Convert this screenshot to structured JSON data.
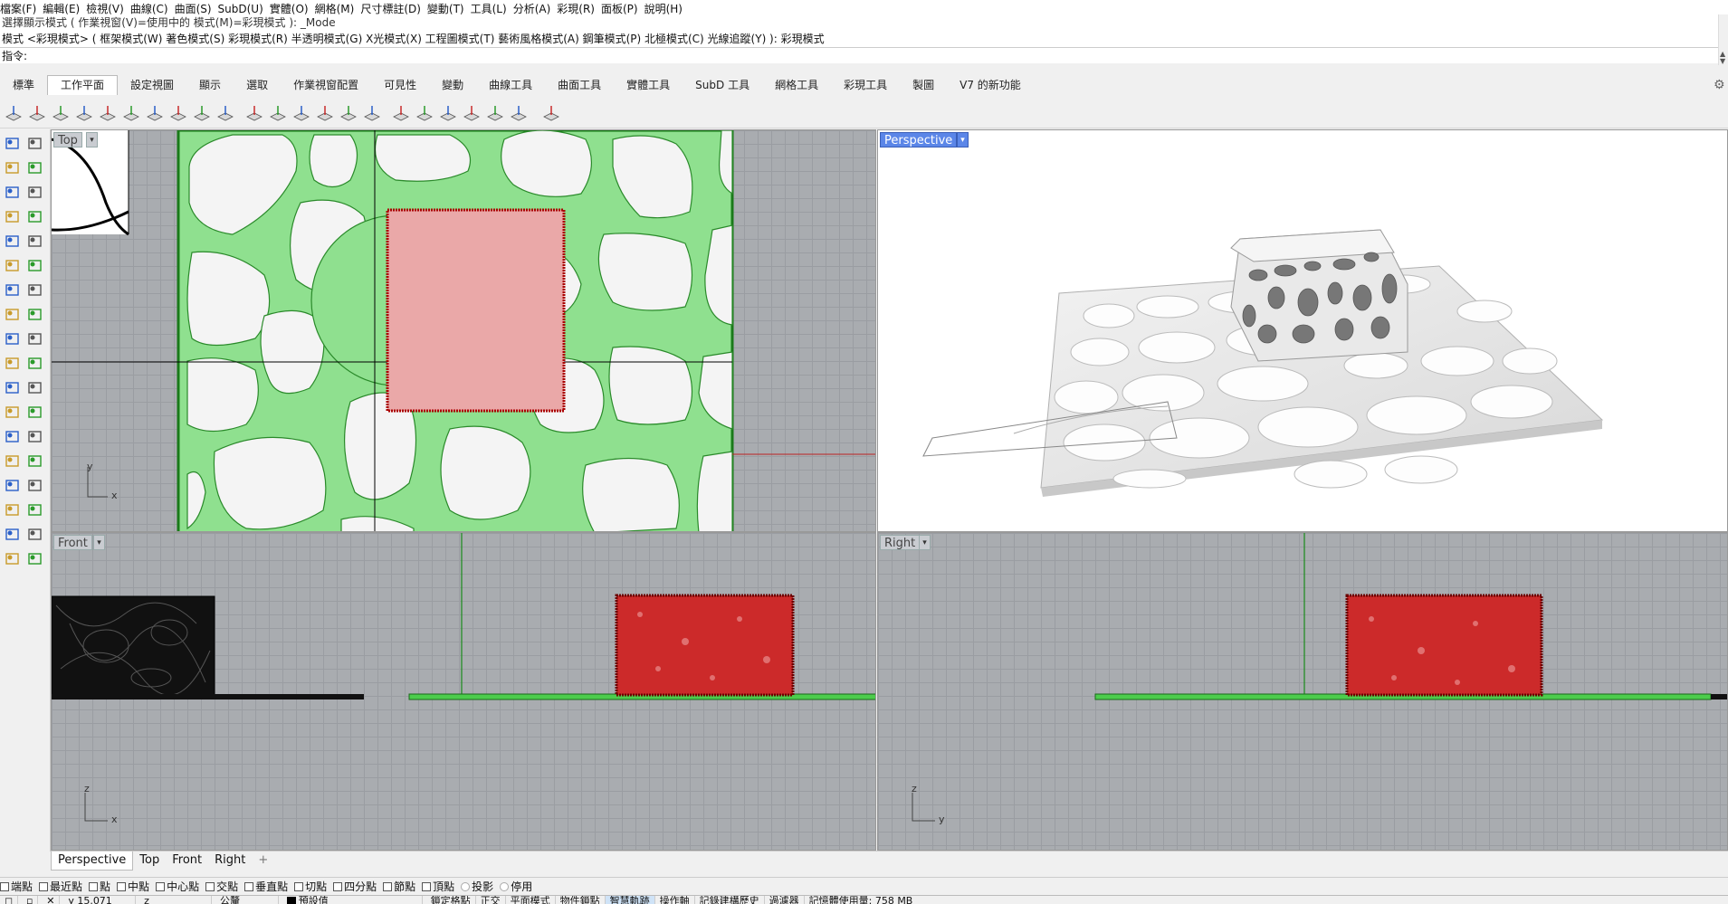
{
  "menu": [
    "檔案(F)",
    "編輯(E)",
    "檢視(V)",
    "曲線(C)",
    "曲面(S)",
    "SubD(U)",
    "實體(O)",
    "網格(M)",
    "尺寸標註(D)",
    "變動(T)",
    "工具(L)",
    "分析(A)",
    "彩現(R)",
    "面板(P)",
    "說明(H)"
  ],
  "command": {
    "history1": "選擇顯示模式 ( 作業視窗(V)=使用中的  模式(M)=彩現模式 ): _Mode",
    "history2": "模式 <彩現模式> ( 框架模式(W)  著色模式(S)  彩現模式(R)  半透明模式(G)  X光模式(X)  工程圖模式(T)  藝術風格模式(A)  鋼筆模式(P)  北極模式(C)  光線追蹤(Y) ): 彩現模式",
    "prompt": "指令:",
    "scroll_up_icon": "caret-up-icon",
    "scroll_down_icon": "caret-down-icon"
  },
  "tabs": [
    "標準",
    "工作平面",
    "設定視圖",
    "顯示",
    "選取",
    "作業視窗配置",
    "可見性",
    "變動",
    "曲線工具",
    "曲面工具",
    "實體工具",
    "SubD 工具",
    "網格工具",
    "彩現工具",
    "製圖",
    "V7 的新功能"
  ],
  "active_tab": "工作平面",
  "viewports": {
    "top": {
      "title": "Top",
      "axis_a": "y",
      "axis_b": "x"
    },
    "perspective": {
      "title": "Perspective"
    },
    "front": {
      "title": "Front",
      "axis_a": "z",
      "axis_b": "x"
    },
    "right": {
      "title": "Right",
      "axis_a": "z",
      "axis_b": "y"
    }
  },
  "viewport_tabs": [
    "Perspective",
    "Top",
    "Front",
    "Right"
  ],
  "viewport_tab_add": "+",
  "osnap": [
    {
      "label": "端點",
      "checked": false,
      "kind": "check"
    },
    {
      "label": "最近點",
      "checked": false,
      "kind": "check"
    },
    {
      "label": "點",
      "checked": false,
      "kind": "check"
    },
    {
      "label": "中點",
      "checked": false,
      "kind": "check"
    },
    {
      "label": "中心點",
      "checked": false,
      "kind": "check"
    },
    {
      "label": "交點",
      "checked": false,
      "kind": "check"
    },
    {
      "label": "垂直點",
      "checked": false,
      "kind": "check"
    },
    {
      "label": "切點",
      "checked": false,
      "kind": "check"
    },
    {
      "label": "四分點",
      "checked": false,
      "kind": "check"
    },
    {
      "label": "節點",
      "checked": false,
      "kind": "check"
    },
    {
      "label": "頂點",
      "checked": false,
      "kind": "check"
    },
    {
      "label": "投影",
      "checked": false,
      "kind": "radio"
    },
    {
      "label": "停用",
      "checked": false,
      "kind": "radio"
    }
  ],
  "status": {
    "coord_y": "y 15.071",
    "coord_z": "z",
    "unit": "公釐",
    "layer": "預設值",
    "items": [
      "鎖定格點",
      "正交",
      "平面模式",
      "物件鎖點",
      "智慧軌跡",
      "操作軸",
      "記錄建構歷史",
      "過濾器",
      "記憶體使用量: 758 MB"
    ],
    "active_item": "智慧軌跡"
  },
  "colors": {
    "selection": "#cc2222",
    "green_mesh": "#8fe08f",
    "grid": "#a9acb0",
    "active_vp": "#5b86e8"
  }
}
